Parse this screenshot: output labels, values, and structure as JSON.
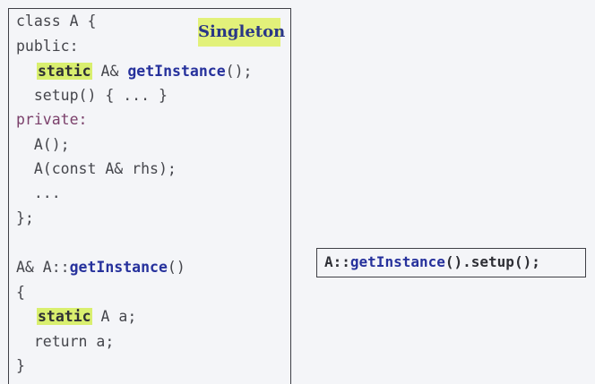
{
  "code_panel": {
    "badge": "Singleton",
    "lines": {
      "class_decl": "class A {",
      "public_label": "public:",
      "static_kw": "static",
      "return_type": " A& ",
      "getinstance_name": "getInstance",
      "decl_tail": "();",
      "setup_line": "  setup() { ... }",
      "private_label": "private:",
      "ctor_line": "  A();",
      "copy_ctor_line": "  A(const A& rhs);",
      "ellipsis_line": "  ...",
      "class_close": "};",
      "def_prefix": "A& A::",
      "def_name": "getInstance",
      "def_tail": "()",
      "open_brace": "{",
      "static_kw2": "static",
      "local_var_tail": " A a;",
      "return_line": "  return a;",
      "close_brace": "}"
    }
  },
  "call_box": {
    "prefix": "A::",
    "method": "getInstance",
    "suffix": "().setup();"
  },
  "colors": {
    "background": "#f4f5f8",
    "highlight": "#d9ef6f",
    "badge_background": "#e2f17a",
    "method_blue": "#26319c",
    "private_keyword": "#7a3f6a",
    "code_text": "#45464c"
  }
}
